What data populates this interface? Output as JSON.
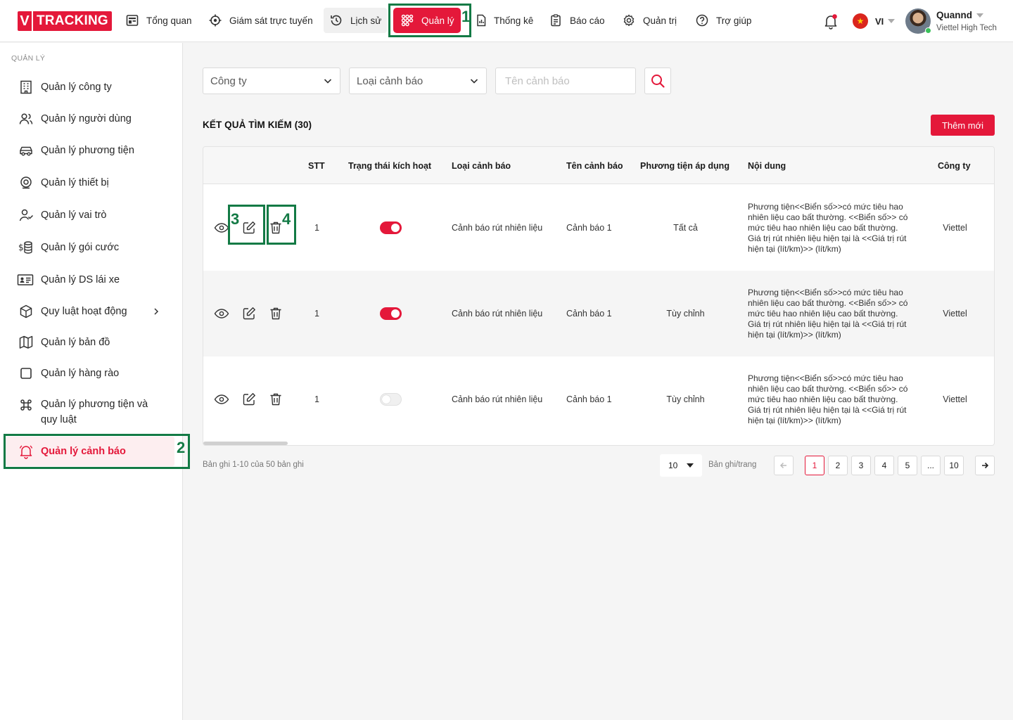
{
  "header": {
    "logo_v": "V",
    "logo_text": "TRACKING",
    "nav": [
      {
        "label": "Tổng quan",
        "icon": "dashboard-icon"
      },
      {
        "label": "Giám sát trực tuyến",
        "icon": "crosshair-icon"
      },
      {
        "label": "Lịch sử",
        "icon": "history-icon"
      },
      {
        "label": "Quản lý",
        "icon": "manage-icon",
        "active": true
      },
      {
        "label": "Thống kê",
        "icon": "chart-file-icon"
      },
      {
        "label": "Báo cáo",
        "icon": "clipboard-icon"
      },
      {
        "label": "Quản trị",
        "icon": "gear-icon"
      },
      {
        "label": "Trợ giúp",
        "icon": "help-icon"
      }
    ],
    "language": "VI",
    "flag_star": "★",
    "user_name": "Quannd",
    "user_org": "Viettel High Tech"
  },
  "sidebar": {
    "title": "QUẢN LÝ",
    "items": [
      {
        "label": "Quản lý công ty",
        "icon": "building-icon"
      },
      {
        "label": "Quản lý người dùng",
        "icon": "users-icon"
      },
      {
        "label": "Quản lý phương tiện",
        "icon": "car-icon"
      },
      {
        "label": "Quản lý thiết bị",
        "icon": "device-icon"
      },
      {
        "label": "Quản lý vai trò",
        "icon": "user-check-icon"
      },
      {
        "label": "Quản lý gói cước",
        "icon": "coins-icon"
      },
      {
        "label": "Quản lý DS lái xe",
        "icon": "id-card-icon"
      },
      {
        "label": "Quy luật hoạt động",
        "icon": "cube-icon"
      },
      {
        "label": "Quản lý bản đồ",
        "icon": "map-icon"
      },
      {
        "label": "Quản lý hàng rào",
        "icon": "square-icon"
      },
      {
        "label": "Quản lý phương tiện và quy luật",
        "icon": "command-icon"
      },
      {
        "label": "Quản lý cảnh báo",
        "icon": "bell-icon",
        "active": true
      }
    ]
  },
  "filters": {
    "company_placeholder": "Công ty",
    "alert_type_placeholder": "Loại cảnh báo",
    "alert_name_placeholder": "Tên cảnh báo"
  },
  "results": {
    "title": "KẾT QUẢ TÌM KIẾM (30)",
    "add_button": "Thêm mới"
  },
  "table": {
    "columns": [
      "STT",
      "Trạng thái kích hoạt",
      "Loại cảnh báo",
      "Tên cảnh báo",
      "Phương tiện áp dụng",
      "Nội dung",
      "Công ty"
    ],
    "rows": [
      {
        "stt": "1",
        "active": true,
        "type": "Cảnh báo rút nhiên liệu",
        "name": "Cảnh báo 1",
        "vehicles": "Tất cả",
        "content": "Phương tiện<<Biển số>>có mức tiêu hao nhiên liệu cao bất thường. <<Biển số>> có mức tiêu hao nhiên liệu cao bất thường. Giá trị rút nhiên liệu hiện tại là <<Giá trị rút hiện tại (lít/km)>> (lít/km)",
        "company": "Viettel"
      },
      {
        "stt": "1",
        "active": true,
        "type": "Cảnh báo rút nhiên liệu",
        "name": "Cảnh báo 1",
        "vehicles": "Tùy chỉnh",
        "content": "Phương tiện<<Biển số>>có mức tiêu hao nhiên liệu cao bất thường. <<Biển số>> có mức tiêu hao nhiên liệu cao bất thường. Giá trị rút nhiên liệu hiện tại là <<Giá trị rút hiện tại (lít/km)>> (lít/km)",
        "company": "Viettel"
      },
      {
        "stt": "1",
        "active": false,
        "type": "Cảnh báo rút nhiên liệu",
        "name": "Cảnh báo 1",
        "vehicles": "Tùy chỉnh",
        "content": "Phương tiện<<Biển số>>có mức tiêu hao nhiên liệu cao bất thường. <<Biển số>> có mức tiêu hao nhiên liệu cao bất thường. Giá trị rút nhiên liệu hiện tại là <<Giá trị rút hiện tại (lít/km)>> (lít/km)",
        "company": "Viettel"
      }
    ]
  },
  "pagination": {
    "info": "Bản ghi 1-10 của 50 bản ghi",
    "page_size": "10",
    "per_page_label": "Bản ghi/trang",
    "pages": [
      "1",
      "2",
      "3",
      "4",
      "5",
      "...",
      "10"
    ],
    "current_page": "1"
  },
  "annotations": [
    "1",
    "2",
    "3",
    "4"
  ],
  "colors": {
    "accent": "#e4183a",
    "annotation": "#137a45"
  }
}
